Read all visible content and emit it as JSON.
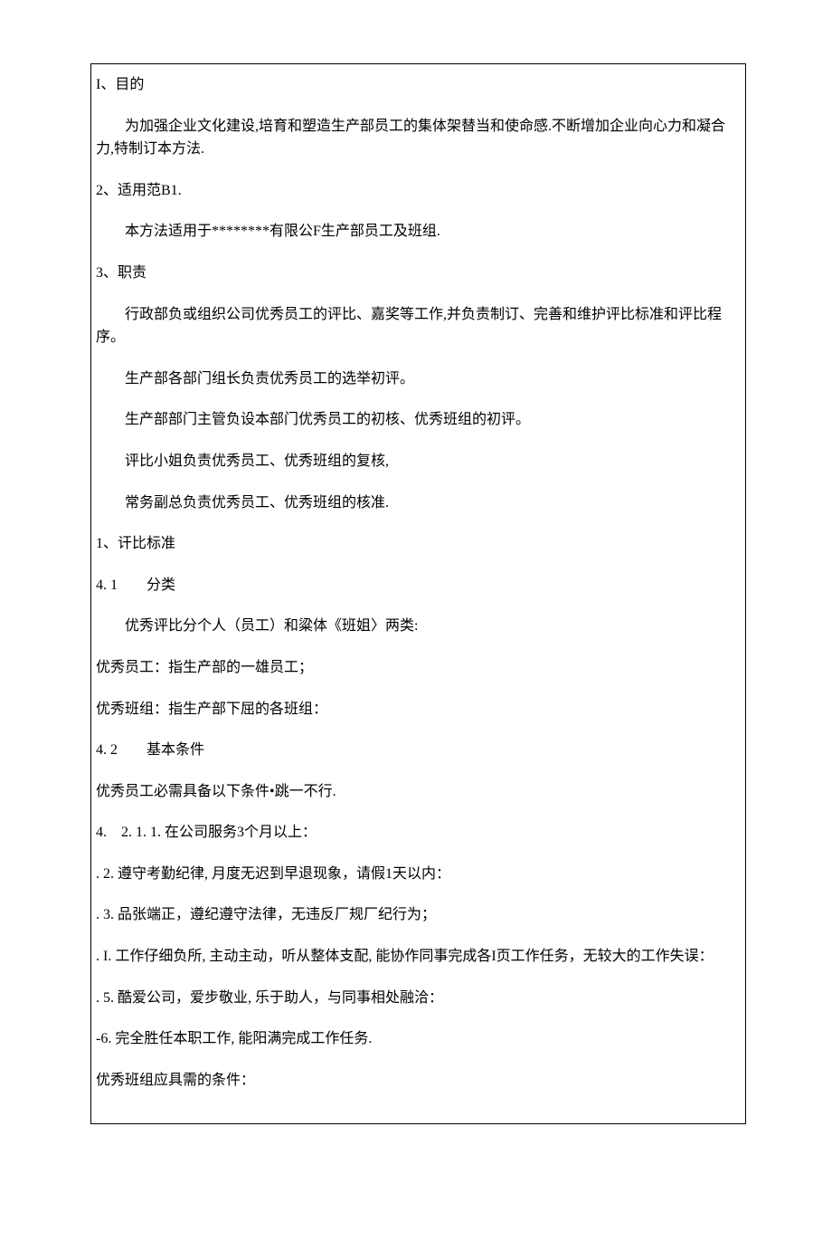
{
  "doc": {
    "s1_heading": "I、目的",
    "s1_p1": "为加强企业文化建设,培育和塑造生产部员工的集体架替当和使命感.不断增加企业向心力和凝合力,特制订本方法.",
    "s2_heading": "2、适用范B1.",
    "s2_p1": "本方法适用于********有限公F生产部员工及班组.",
    "s3_heading": "3、职责",
    "s3_p1": "行政部负或组织公司优秀员工的评比、嘉奖等工作,并负责制订、完善和维护评比标准和评比程序。",
    "s3_p2": "生产部各部门组长负责优秀员工的选举初评。",
    "s3_p3": "生产部部门主管负设本部门优秀员工的初核、优秀班组的初评。",
    "s3_p4": "评比小姐负责优秀员工、优秀班组的复核,",
    "s3_p5": "常务副总负责优秀员工、优秀班组的核准.",
    "s4_heading": "1、讦比标准",
    "s4_1_heading": "4. 1　　分类",
    "s4_1_p1": "优秀评比分个人（员工）和粱体《班姐〉两类:",
    "s4_1_p2": "优秀员工：指生产部的一雄员工；",
    "s4_1_p3": "优秀班组：指生产部下屈的各班组：",
    "s4_2_heading": "4. 2　　基本条件",
    "s4_2_p1": "优秀员工必需具备以下条件•跳一不行.",
    "s4_2_item1": "4.　2. 1. 1. 在公司服务3个月以上：",
    "s4_2_item2": ". 2. 遵守考勤纪律, 月度无迟到早退现象，请假1天以内：",
    "s4_2_item3": ". 3. 品张端正，遵纪遵守法律，无违反厂规厂纪行为；",
    "s4_2_item4": ". I. 工作仔细负所, 主动主动，听从整体支配, 能协作同事完成各I页工作任务，无较大的工作失误：",
    "s4_2_item5": ". 5. 酷爱公司，爱步敬业, 乐于助人，与同事相处融洽：",
    "s4_2_item6": "-6. 完全胜任本职工作, 能阳满完成工作任务.",
    "s4_2_p2": "优秀班组应具需的条件："
  }
}
